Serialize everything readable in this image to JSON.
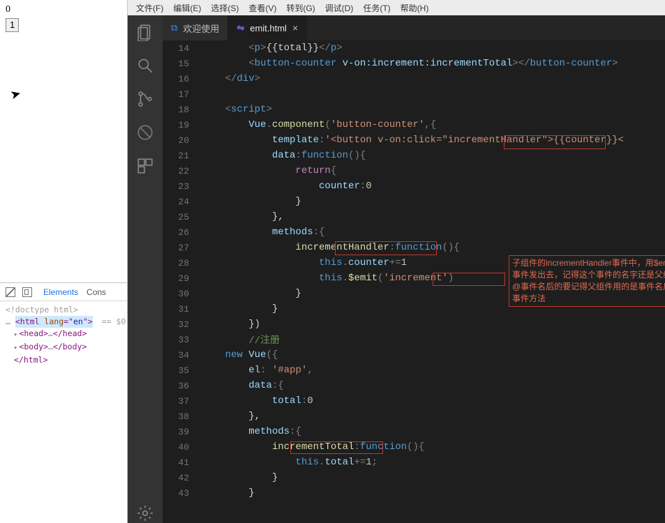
{
  "preview": {
    "count": "0",
    "button_value": "1"
  },
  "devtools": {
    "tabs": {
      "elements": "Elements",
      "console": "Cons"
    },
    "dom": {
      "doctype": "<!doctype html>",
      "html_open_prefix": "<html ",
      "html_lang_attr": "lang",
      "html_lang_val": "en",
      "html_open_suffix": ">",
      "selected_marker": "== $0",
      "head_open": "<head>",
      "head_dots": "…",
      "head_close": "</head>",
      "body_open": "<body>",
      "body_dots": "…",
      "body_close": "</body>",
      "html_close": "</html>"
    }
  },
  "menubar": {
    "file": "文件(F)",
    "edit": "编辑(E)",
    "select": "选择(S)",
    "view": "查看(V)",
    "goto": "转到(G)",
    "debug": "调试(D)",
    "tasks": "任务(T)",
    "help": "帮助(H)"
  },
  "tabs": {
    "welcome": "欢迎使用",
    "file_symbol": "⇋",
    "active_file": "emit.html",
    "close_glyph": "×"
  },
  "annotation_box_text": "子组件的incrementHandler事件中，用$emit将事件发出去，记得这个事件的名字还是父组件@事件名后的要记得父组件用的是事件名后的事件方法",
  "code": [
    {
      "n": 14,
      "seg": [
        [
          "pun",
          "        <"
        ],
        [
          "tagc",
          "p"
        ],
        [
          "pun",
          ">"
        ],
        [
          "ln",
          "{{total}}"
        ],
        [
          "pun",
          "</"
        ],
        [
          "tagc",
          "p"
        ],
        [
          "pun",
          ">"
        ]
      ]
    },
    {
      "n": 15,
      "seg": [
        [
          "pun",
          "        <"
        ],
        [
          "tagc",
          "button-counter"
        ],
        [
          "ln",
          " "
        ],
        [
          "attrN",
          "v-on:increment:incrementTotal"
        ],
        [
          "pun",
          "></"
        ],
        [
          "tagc",
          "button-counter"
        ],
        [
          "pun",
          ">"
        ]
      ]
    },
    {
      "n": 16,
      "seg": [
        [
          "pun",
          "    </"
        ],
        [
          "tagc",
          "div"
        ],
        [
          "pun",
          ">"
        ]
      ]
    },
    {
      "n": 17,
      "seg": [
        [
          "ln",
          ""
        ]
      ]
    },
    {
      "n": 18,
      "seg": [
        [
          "pun",
          "    <"
        ],
        [
          "tagc",
          "script"
        ],
        [
          "pun",
          ">"
        ]
      ]
    },
    {
      "n": 19,
      "seg": [
        [
          "ln",
          "        "
        ],
        [
          "var",
          "Vue"
        ],
        [
          "pun",
          "."
        ],
        [
          "func",
          "component"
        ],
        [
          "pun",
          "("
        ],
        [
          "str",
          "'button-counter'"
        ],
        [
          "pun",
          ",{"
        ]
      ]
    },
    {
      "n": 20,
      "seg": [
        [
          "ln",
          "            "
        ],
        [
          "prop",
          "template"
        ],
        [
          "pun",
          ":"
        ],
        [
          "str",
          "'<button v-on:click=\""
        ],
        [
          "strE",
          "incrementHandler"
        ],
        [
          "str",
          "\">{{counter}}<"
        ]
      ]
    },
    {
      "n": 21,
      "seg": [
        [
          "ln",
          "            "
        ],
        [
          "prop",
          "data"
        ],
        [
          "pun",
          ":"
        ],
        [
          "kw",
          "function"
        ],
        [
          "pun",
          "(){"
        ]
      ]
    },
    {
      "n": 22,
      "seg": [
        [
          "ln",
          "                "
        ],
        [
          "dir",
          "return"
        ],
        [
          "pun",
          "{"
        ]
      ]
    },
    {
      "n": 23,
      "seg": [
        [
          "ln",
          "                    "
        ],
        [
          "prop",
          "counter"
        ],
        [
          "pun",
          ":"
        ],
        [
          "num",
          "0"
        ]
      ]
    },
    {
      "n": 24,
      "seg": [
        [
          "ln",
          "                }"
        ]
      ]
    },
    {
      "n": 25,
      "seg": [
        [
          "ln",
          "            },"
        ]
      ]
    },
    {
      "n": 26,
      "seg": [
        [
          "ln",
          "            "
        ],
        [
          "prop",
          "methods"
        ],
        [
          "pun",
          ":{"
        ]
      ]
    },
    {
      "n": 27,
      "seg": [
        [
          "ln",
          "                "
        ],
        [
          "funcE",
          "incrementHandler"
        ],
        [
          "pun",
          ":"
        ],
        [
          "kw",
          "function"
        ],
        [
          "pun",
          "(){"
        ]
      ]
    },
    {
      "n": 28,
      "seg": [
        [
          "ln",
          "                    "
        ],
        [
          "this",
          "this"
        ],
        [
          "pun",
          "."
        ],
        [
          "prop",
          "counter"
        ],
        [
          "pun",
          "+="
        ],
        [
          "num",
          "1"
        ]
      ]
    },
    {
      "n": 29,
      "seg": [
        [
          "ln",
          "                    "
        ],
        [
          "this",
          "this"
        ],
        [
          "pun",
          "."
        ],
        [
          "func",
          "$emit"
        ],
        [
          "pun",
          "("
        ],
        [
          "strE2",
          "'increment'"
        ],
        [
          "pun",
          ")"
        ]
      ]
    },
    {
      "n": 30,
      "seg": [
        [
          "ln",
          "                }"
        ]
      ]
    },
    {
      "n": 31,
      "seg": [
        [
          "ln",
          "            }"
        ]
      ]
    },
    {
      "n": 32,
      "seg": [
        [
          "ln",
          "        })"
        ]
      ]
    },
    {
      "n": 33,
      "seg": [
        [
          "ln",
          "        "
        ],
        [
          "cmt",
          "//注册"
        ]
      ]
    },
    {
      "n": 34,
      "seg": [
        [
          "ln",
          "    "
        ],
        [
          "kw",
          "new"
        ],
        [
          "ln",
          " "
        ],
        [
          "var",
          "Vue"
        ],
        [
          "pun",
          "({"
        ]
      ]
    },
    {
      "n": 35,
      "seg": [
        [
          "ln",
          "        "
        ],
        [
          "prop",
          "el"
        ],
        [
          "pun",
          ": "
        ],
        [
          "str",
          "'#app'"
        ],
        [
          "pun",
          ","
        ]
      ]
    },
    {
      "n": 36,
      "seg": [
        [
          "ln",
          "        "
        ],
        [
          "prop",
          "data"
        ],
        [
          "pun",
          ":{"
        ]
      ]
    },
    {
      "n": 37,
      "seg": [
        [
          "ln",
          "            "
        ],
        [
          "prop",
          "total"
        ],
        [
          "pun",
          ":"
        ],
        [
          "num",
          "0"
        ]
      ]
    },
    {
      "n": 38,
      "seg": [
        [
          "ln",
          "        },"
        ]
      ]
    },
    {
      "n": 39,
      "seg": [
        [
          "ln",
          "        "
        ],
        [
          "prop",
          "methods"
        ],
        [
          "pun",
          ":{"
        ]
      ]
    },
    {
      "n": 40,
      "seg": [
        [
          "ln",
          "            "
        ],
        [
          "funcE3",
          "incrementTotal"
        ],
        [
          "pun",
          ":"
        ],
        [
          "kw",
          "function"
        ],
        [
          "pun",
          "(){"
        ]
      ]
    },
    {
      "n": 41,
      "seg": [
        [
          "ln",
          "                "
        ],
        [
          "this",
          "this"
        ],
        [
          "pun",
          "."
        ],
        [
          "prop",
          "total"
        ],
        [
          "pun",
          "+="
        ],
        [
          "num",
          "1"
        ],
        [
          "pun",
          ";"
        ]
      ]
    },
    {
      "n": 42,
      "seg": [
        [
          "ln",
          "            }"
        ]
      ]
    },
    {
      "n": 43,
      "seg": [
        [
          "ln",
          "        }"
        ]
      ]
    }
  ]
}
